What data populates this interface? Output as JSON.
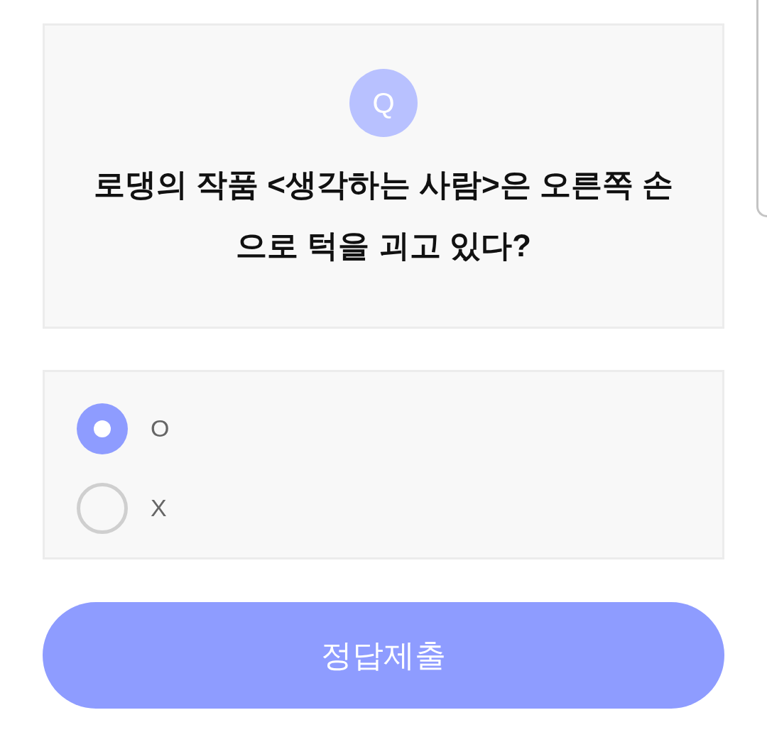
{
  "question": {
    "badge": "Q",
    "text": "로댕의 작품 <생각하는 사람>은 오른쪽 손으로 턱을 괴고 있다?"
  },
  "options": [
    {
      "label": "O",
      "selected": true
    },
    {
      "label": "X",
      "selected": false
    }
  ],
  "submit_button": {
    "label": "정답제출"
  }
}
